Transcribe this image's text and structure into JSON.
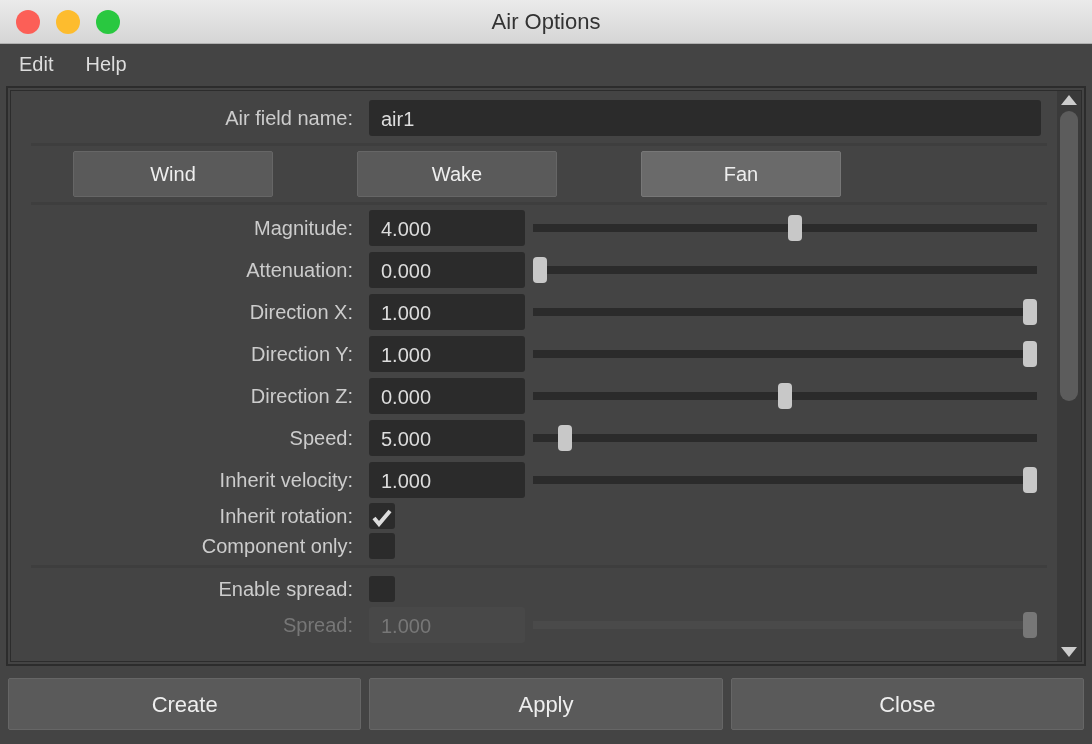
{
  "window": {
    "title": "Air Options"
  },
  "menu": [
    "Edit",
    "Help"
  ],
  "name_field": {
    "label": "Air field name:",
    "value": "air1"
  },
  "modes": [
    {
      "label": "Wind",
      "selected": false
    },
    {
      "label": "Wake",
      "selected": false
    },
    {
      "label": "Fan",
      "selected": true
    }
  ],
  "rows": [
    {
      "kind": "slider",
      "label": "Magnitude:",
      "value": "4.000",
      "level": 0.52,
      "disabled": false
    },
    {
      "kind": "slider",
      "label": "Attenuation:",
      "value": "0.000",
      "level": 0,
      "disabled": false
    },
    {
      "kind": "slider",
      "label": "Direction X:",
      "value": "1.000",
      "level": 1,
      "disabled": false
    },
    {
      "kind": "slider",
      "label": "Direction Y:",
      "value": "1.000",
      "level": 1,
      "disabled": false
    },
    {
      "kind": "slider",
      "label": "Direction Z:",
      "value": "0.000",
      "level": 0.5,
      "disabled": false
    },
    {
      "kind": "slider",
      "label": "Speed:",
      "value": "5.000",
      "level": 0.05,
      "disabled": false
    },
    {
      "kind": "slider",
      "label": "Inherit velocity:",
      "value": "1.000",
      "level": 1,
      "disabled": false
    },
    {
      "kind": "checkbox",
      "label": "Inherit rotation:",
      "checked": true
    },
    {
      "kind": "checkbox",
      "label": "Component only:",
      "checked": false
    },
    {
      "kind": "separator"
    },
    {
      "kind": "checkbox",
      "label": "Enable spread:",
      "checked": false
    },
    {
      "kind": "slider",
      "label": "Spread:",
      "value": "1.000",
      "level": 1,
      "disabled": true
    }
  ],
  "buttons": [
    "Create",
    "Apply",
    "Close"
  ]
}
